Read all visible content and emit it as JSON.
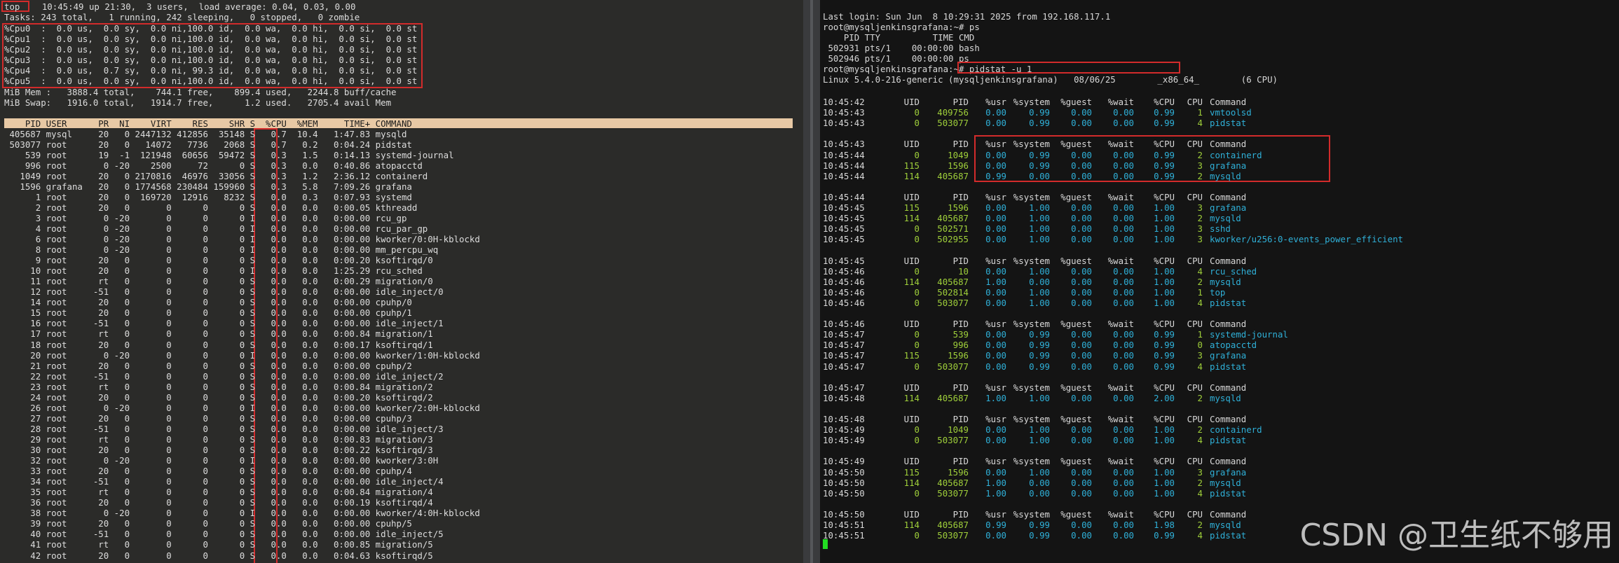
{
  "top_panel": {
    "prompt_label": "top",
    "header": [
      "    10:45:49 up 21:30,  3 users,  load average: 0.04, 0.03, 0.00",
      "Tasks: 243 total,   1 running, 242 sleeping,   0 stopped,   0 zombie"
    ],
    "cpu_lines": [
      "%Cpu0  :  0.0 us,  0.0 sy,  0.0 ni,100.0 id,  0.0 wa,  0.0 hi,  0.0 si,  0.0 st",
      "%Cpu1  :  0.0 us,  0.0 sy,  0.0 ni,100.0 id,  0.0 wa,  0.0 hi,  0.0 si,  0.0 st",
      "%Cpu2  :  0.0 us,  0.0 sy,  0.0 ni,100.0 id,  0.0 wa,  0.0 hi,  0.0 si,  0.0 st",
      "%Cpu3  :  0.0 us,  0.0 sy,  0.0 ni,100.0 id,  0.0 wa,  0.0 hi,  0.0 si,  0.0 st",
      "%Cpu4  :  0.0 us,  0.7 sy,  0.0 ni, 99.3 id,  0.0 wa,  0.0 hi,  0.0 si,  0.0 st",
      "%Cpu5  :  0.0 us,  0.0 sy,  0.0 ni,100.0 id,  0.0 wa,  0.0 hi,  0.0 si,  0.0 st"
    ],
    "mem_lines": [
      "MiB Mem :   3888.4 total,    744.1 free,    899.4 used,   2244.8 buff/cache",
      "MiB Swap:   1916.0 total,   1914.7 free,      1.2 used.   2705.4 avail Mem"
    ],
    "table_header": "    PID USER      PR  NI    VIRT    RES    SHR S  %CPU  %MEM     TIME+ COMMAND",
    "rows": [
      " 405687 mysql     20   0 2447132 412856  35148 S   0.7  10.4   1:47.83 mysqld",
      " 503077 root      20   0   14072   7736   2068 S   0.7   0.2   0:04.24 pidstat",
      "    539 root      19  -1  121948  60656  59472 S   0.3   1.5   0:14.13 systemd-journal",
      "    996 root       0 -20    2500     72      0 S   0.3   0.0   0:40.86 atopacctd",
      "   1049 root      20   0 2170816  46976  33056 S   0.3   1.2   2:36.12 containerd",
      "   1596 grafana   20   0 1774568 230484 159960 S   0.3   5.8   7:09.26 grafana",
      "      1 root      20   0  169720  12916   8232 S   0.0   0.3   0:07.93 systemd",
      "      2 root      20   0       0      0      0 S   0.0   0.0   0:00.05 kthreadd",
      "      3 root       0 -20       0      0      0 I   0.0   0.0   0:00.00 rcu_gp",
      "      4 root       0 -20       0      0      0 I   0.0   0.0   0:00.00 rcu_par_gp",
      "      6 root       0 -20       0      0      0 I   0.0   0.0   0:00.00 kworker/0:0H-kblockd",
      "      8 root       0 -20       0      0      0 I   0.0   0.0   0:00.00 mm_percpu_wq",
      "      9 root      20   0       0      0      0 S   0.0   0.0   0:00.20 ksoftirqd/0",
      "     10 root      20   0       0      0      0 I   0.0   0.0   1:25.29 rcu_sched",
      "     11 root      rt   0       0      0      0 S   0.0   0.0   0:00.29 migration/0",
      "     12 root     -51   0       0      0      0 S   0.0   0.0   0:00.00 idle_inject/0",
      "     14 root      20   0       0      0      0 S   0.0   0.0   0:00.00 cpuhp/0",
      "     15 root      20   0       0      0      0 S   0.0   0.0   0:00.00 cpuhp/1",
      "     16 root     -51   0       0      0      0 S   0.0   0.0   0:00.00 idle_inject/1",
      "     17 root      rt   0       0      0      0 S   0.0   0.0   0:00.84 migration/1",
      "     18 root      20   0       0      0      0 S   0.0   0.0   0:00.17 ksoftirqd/1",
      "     20 root       0 -20       0      0      0 I   0.0   0.0   0:00.00 kworker/1:0H-kblockd",
      "     21 root      20   0       0      0      0 S   0.0   0.0   0:00.00 cpuhp/2",
      "     22 root     -51   0       0      0      0 S   0.0   0.0   0:00.00 idle_inject/2",
      "     23 root      rt   0       0      0      0 S   0.0   0.0   0:00.84 migration/2",
      "     24 root      20   0       0      0      0 S   0.0   0.0   0:00.20 ksoftirqd/2",
      "     26 root       0 -20       0      0      0 I   0.0   0.0   0:00.00 kworker/2:0H-kblockd",
      "     27 root      20   0       0      0      0 S   0.0   0.0   0:00.00 cpuhp/3",
      "     28 root     -51   0       0      0      0 S   0.0   0.0   0:00.00 idle_inject/3",
      "     29 root      rt   0       0      0      0 S   0.0   0.0   0:00.83 migration/3",
      "     30 root      20   0       0      0      0 S   0.0   0.0   0:00.22 ksoftirqd/3",
      "     32 root       0 -20       0      0      0 I   0.0   0.0   0:00.00 kworker/3:0H",
      "     33 root      20   0       0      0      0 S   0.0   0.0   0:00.00 cpuhp/4",
      "     34 root     -51   0       0      0      0 S   0.0   0.0   0:00.00 idle_inject/4",
      "     35 root      rt   0       0      0      0 S   0.0   0.0   0:00.84 migration/4",
      "     36 root      20   0       0      0      0 S   0.0   0.0   0:00.19 ksoftirqd/4",
      "     38 root       0 -20       0      0      0 I   0.0   0.0   0:00.00 kworker/4:0H-kblockd",
      "     39 root      20   0       0      0      0 S   0.0   0.0   0:00.00 cpuhp/5",
      "     40 root     -51   0       0      0      0 S   0.0   0.0   0:00.00 idle_inject/5",
      "     41 root      rt   0       0      0      0 S   0.0   0.0   0:00.85 migration/5",
      "     42 root      20   0       0      0      0 S   0.0   0.0   0:04.63 ksoftirqd/5"
    ]
  },
  "pidstat_panel": {
    "intro": [
      "Last login: Sun Jun  8 10:29:31 2025 from 192.168.117.1",
      "root@mysqljenkinsgrafana:~# ps",
      "    PID TTY          TIME CMD",
      " 502931 pts/1    00:00:00 bash",
      " 502946 pts/1    00:00:00 ps",
      "root@mysqljenkinsgrafana:~# pidstat -u 1",
      "Linux 5.4.0-216-generic (mysqljenkinsgrafana)   08/06/25        _x86_64_        (6 CPU)"
    ],
    "header_cols": [
      "UID",
      "PID",
      "%usr",
      "%system",
      "%guest",
      "%wait",
      "%CPU",
      "CPU",
      "Command"
    ],
    "blocks": [
      {
        "time": "10:45:42",
        "rows": [
          [
            "10:45:43",
            "0",
            "409756",
            "0.00",
            "0.99",
            "0.00",
            "0.00",
            "0.99",
            "1",
            "vmtoolsd"
          ],
          [
            "10:45:43",
            "0",
            "503077",
            "0.00",
            "0.99",
            "0.00",
            "0.00",
            "0.99",
            "4",
            "pidstat"
          ]
        ]
      },
      {
        "time": "10:45:43",
        "rows": [
          [
            "10:45:44",
            "0",
            "1049",
            "0.00",
            "0.99",
            "0.00",
            "0.00",
            "0.99",
            "2",
            "containerd"
          ],
          [
            "10:45:44",
            "115",
            "1596",
            "0.00",
            "0.99",
            "0.00",
            "0.00",
            "0.99",
            "3",
            "grafana"
          ],
          [
            "10:45:44",
            "114",
            "405687",
            "0.99",
            "0.00",
            "0.00",
            "0.00",
            "0.99",
            "2",
            "mysqld"
          ]
        ]
      },
      {
        "time": "10:45:44",
        "rows": [
          [
            "10:45:45",
            "115",
            "1596",
            "0.00",
            "1.00",
            "0.00",
            "0.00",
            "1.00",
            "3",
            "grafana"
          ],
          [
            "10:45:45",
            "114",
            "405687",
            "0.00",
            "1.00",
            "0.00",
            "0.00",
            "1.00",
            "2",
            "mysqld"
          ],
          [
            "10:45:45",
            "0",
            "502571",
            "0.00",
            "1.00",
            "0.00",
            "0.00",
            "1.00",
            "3",
            "sshd"
          ],
          [
            "10:45:45",
            "0",
            "502955",
            "0.00",
            "1.00",
            "0.00",
            "0.00",
            "1.00",
            "3",
            "kworker/u256:0-events_power_efficient"
          ]
        ]
      },
      {
        "time": "10:45:45",
        "rows": [
          [
            "10:45:46",
            "0",
            "10",
            "0.00",
            "1.00",
            "0.00",
            "0.00",
            "1.00",
            "4",
            "rcu_sched"
          ],
          [
            "10:45:46",
            "114",
            "405687",
            "1.00",
            "0.00",
            "0.00",
            "0.00",
            "1.00",
            "2",
            "mysqld"
          ],
          [
            "10:45:46",
            "0",
            "502814",
            "0.00",
            "1.00",
            "0.00",
            "0.00",
            "1.00",
            "1",
            "top"
          ],
          [
            "10:45:46",
            "0",
            "503077",
            "0.00",
            "1.00",
            "0.00",
            "0.00",
            "1.00",
            "4",
            "pidstat"
          ]
        ]
      },
      {
        "time": "10:45:46",
        "rows": [
          [
            "10:45:47",
            "0",
            "539",
            "0.00",
            "0.99",
            "0.00",
            "0.00",
            "0.99",
            "1",
            "systemd-journal"
          ],
          [
            "10:45:47",
            "0",
            "996",
            "0.00",
            "0.99",
            "0.00",
            "0.00",
            "0.99",
            "0",
            "atopacctd"
          ],
          [
            "10:45:47",
            "115",
            "1596",
            "0.00",
            "0.99",
            "0.00",
            "0.00",
            "0.99",
            "3",
            "grafana"
          ],
          [
            "10:45:47",
            "0",
            "503077",
            "0.00",
            "0.99",
            "0.00",
            "0.00",
            "0.99",
            "4",
            "pidstat"
          ]
        ]
      },
      {
        "time": "10:45:47",
        "rows": [
          [
            "10:45:48",
            "114",
            "405687",
            "1.00",
            "1.00",
            "0.00",
            "0.00",
            "2.00",
            "2",
            "mysqld"
          ]
        ]
      },
      {
        "time": "10:45:48",
        "rows": [
          [
            "10:45:49",
            "0",
            "1049",
            "0.00",
            "1.00",
            "0.00",
            "0.00",
            "1.00",
            "2",
            "containerd"
          ],
          [
            "10:45:49",
            "0",
            "503077",
            "0.00",
            "1.00",
            "0.00",
            "0.00",
            "1.00",
            "4",
            "pidstat"
          ]
        ]
      },
      {
        "time": "10:45:49",
        "rows": [
          [
            "10:45:50",
            "115",
            "1596",
            "0.00",
            "1.00",
            "0.00",
            "0.00",
            "1.00",
            "3",
            "grafana"
          ],
          [
            "10:45:50",
            "114",
            "405687",
            "1.00",
            "0.00",
            "0.00",
            "0.00",
            "1.00",
            "2",
            "mysqld"
          ],
          [
            "10:45:50",
            "0",
            "503077",
            "1.00",
            "0.00",
            "0.00",
            "0.00",
            "1.00",
            "4",
            "pidstat"
          ]
        ]
      },
      {
        "time": "10:45:50",
        "rows": [
          [
            "10:45:51",
            "114",
            "405687",
            "0.99",
            "0.99",
            "0.00",
            "0.00",
            "1.98",
            "2",
            "mysqld"
          ],
          [
            "10:45:51",
            "0",
            "503077",
            "0.00",
            "0.99",
            "0.00",
            "0.00",
            "0.99",
            "4",
            "pidstat"
          ]
        ]
      }
    ]
  },
  "watermark": "CSDN @卫生纸不够用",
  "colors": {
    "highlight_box": "#d22b2b",
    "command_cyan": "#2fb0d8",
    "number_green": "#9fcf3a",
    "header_bar": "#e8c9a5"
  }
}
